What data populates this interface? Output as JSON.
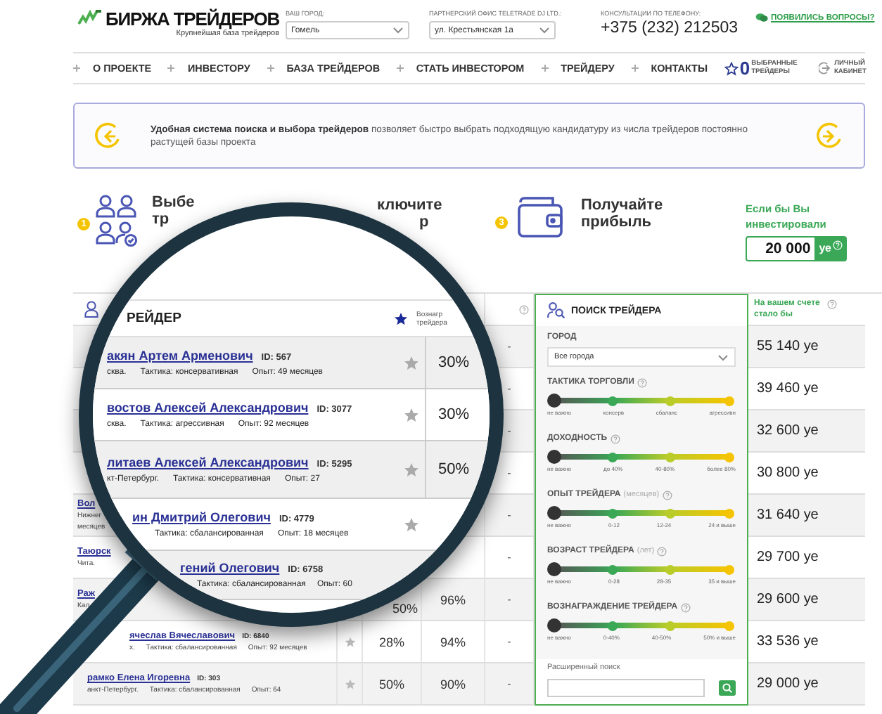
{
  "header": {
    "logo_title": "БИРЖА ТРЕЙДЕРОВ",
    "logo_subtitle": "Крупнейшая база трейдеров",
    "city": {
      "label": "ВАШ ГОРОД:",
      "value": "Гомель"
    },
    "office": {
      "label": "ПАРТНЕРСКИЙ ОФИС TELETRADE DJ LTD.:",
      "value": "ул. Крестьянская 1а"
    },
    "phone": {
      "label": "КОНСУЛЬТАЦИИ ПО ТЕЛЕФОНУ:",
      "value": "+375 (232) 212503"
    },
    "questions_link": "ПОЯВИЛИСЬ ВОПРОСЫ?"
  },
  "nav": {
    "items": [
      "О ПРОЕКТЕ",
      "ИНВЕСТОРУ",
      "БАЗА ТРЕЙДЕРОВ",
      "СТАТЬ ИНВЕСТОРОМ",
      "ТРЕЙДЕРУ",
      "КОНТАКТЫ"
    ],
    "favorites": {
      "count": "0",
      "label": "ВЫБРАННЫЕ ТРЕЙДЕРЫ"
    },
    "account": "ЛИЧНЫЙ КАБИНЕТ"
  },
  "banner": {
    "text": "**Удобная система поиска и выбора трейдеров** позволяет быстро выбрать подходящую кандидатуру из числа трейдеров постоянно растущей базы проекта"
  },
  "steps": [
    {
      "kind": "traders",
      "number": "1",
      "lines": [
        "Выбе",
        "тр"
      ]
    },
    {
      "kind": "connect",
      "lines": [
        "ключите",
        "р"
      ]
    },
    {
      "kind": "wallet",
      "number": "3",
      "lines": [
        "Получайте",
        "прибыль"
      ]
    }
  ],
  "calculator": {
    "label": "Если бы Вы инвестировали",
    "amount": "20 000",
    "currency": "уе"
  },
  "table": {
    "result_header": "На вашем счете стало бы",
    "rows": [
      {
        "dash": "-",
        "result": "55 140 уе"
      },
      {
        "dash": "-",
        "result": "39 460 уе"
      },
      {
        "dash": "-",
        "result": "32 600 уе"
      },
      {
        "dash": "-",
        "result": "30 800 уе"
      },
      {
        "name": "Вол",
        "city": "Нижнег",
        "extra": "месяцев",
        "dash": "-",
        "result": "31 640 уе"
      },
      {
        "name": "Таюрск",
        "city": "Чита.",
        "dash": "-",
        "result": "29 700 уе"
      },
      {
        "name": "Раж",
        "city": "Кал",
        "pct_1": "50%",
        "pct_2": "96%",
        "dash": "-",
        "result": "29 600 уе"
      },
      {
        "name": "ячеслав Вячеславович",
        "id": "ID: 6840",
        "city": "х.",
        "tactic": "Тактика: сбалансированная",
        "experience": "Опыт: 92 месяцев",
        "favorite": false,
        "pct_1": "28%",
        "pct_2": "94%",
        "dash": "-",
        "result": "33 536 уе"
      },
      {
        "name": "рамко Елена Игоревна",
        "id": "ID: 303",
        "city": "анкт-Петербург.",
        "tactic": "Тактика: сбалансированная",
        "experience": "Опыт: 64",
        "favorite": false,
        "pct_1": "50%",
        "pct_2": "90%",
        "dash": "-",
        "result": "29 000 уе"
      }
    ]
  },
  "lens": {
    "header": {
      "trader": "РЕЙДЕР",
      "reward": "Вознагр трейдера"
    },
    "rows": [
      {
        "name": "акян Артем Арменович",
        "id": "ID: 567",
        "city": "сква.",
        "tactic": "Тактика: консервативная",
        "experience": "Опыт: 49 месяцев",
        "favorite": false,
        "percent": "30%"
      },
      {
        "name": "востов Алексей Александрович",
        "id": "ID: 3077",
        "city": "сква.",
        "tactic": "Тактика: агрессивная",
        "experience": "Опыт: 92 месяцев",
        "favorite": false,
        "percent": "30%"
      },
      {
        "name": "литаев Алексей Александрович",
        "id": "ID: 5295",
        "city": "кт-Петербург.",
        "tactic": "Тактика: консервативная",
        "experience": "Опыт: 27",
        "favorite": false,
        "percent": "50%"
      },
      {
        "name": "ин Дмитрий Олегович",
        "id": "ID: 4779",
        "tactic": "Тактика: сбалансированная",
        "experience": "Опыт: 18 месяцев",
        "favorite": false
      },
      {
        "name": "гений Олегович",
        "id": "ID: 6758",
        "tactic": "Тактика: сбалансированная",
        "experience": "Опыт: 60"
      }
    ]
  },
  "search_panel": {
    "title": "ПОИСК ТРЕЙДЕРА",
    "city": {
      "label": "ГОРОД",
      "value": "Все города"
    },
    "filters": [
      {
        "label": "ТАКТИКА ТОРГОВЛИ",
        "level": 0,
        "ticks": [
          "не важно",
          "консерв",
          "сбаланс",
          "агрессивн"
        ]
      },
      {
        "label": "ДОХОДНОСТЬ",
        "level": 0,
        "ticks": [
          "не важно",
          "до 40%",
          "40-80%",
          "более 80%"
        ]
      },
      {
        "label": "ОПЫТ ТРЕЙДЕРА",
        "hint": "(месяцев)",
        "level": 0,
        "ticks": [
          "не важно",
          "0-12",
          "12-24",
          "24 и выше"
        ]
      },
      {
        "label": "ВОЗРАСТ ТРЕЙДЕРА",
        "hint": "(лет)",
        "level": 0,
        "ticks": [
          "не важно",
          "0-28",
          "28-35",
          "35 и выше"
        ]
      },
      {
        "label": "ВОЗНАГРАЖДЕНИЕ ТРЕЙДЕРА",
        "level": 0,
        "ticks": [
          "не важно",
          "0-40%",
          "40-50%",
          "50% и выше"
        ]
      }
    ],
    "advanced_label": "Расширенный поиск"
  }
}
